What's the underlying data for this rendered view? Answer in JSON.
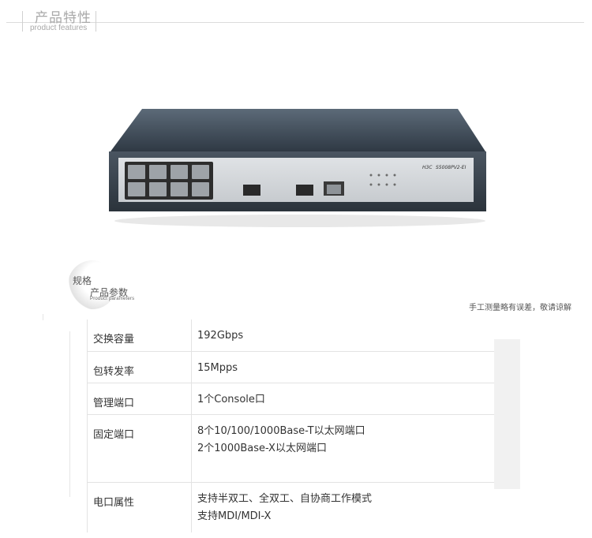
{
  "header": {
    "title": "产品特性",
    "subtitle": "product features"
  },
  "product_image": {
    "brand": "H3C",
    "model": "S5008PV2-EI"
  },
  "specs": {
    "heading_cn": "规格",
    "heading_param": "产品参数",
    "heading_en": "Product parameters",
    "note": "手工测量略有误差，敬请谅解",
    "rows": [
      {
        "label": "交换容量",
        "value": [
          "192Gbps"
        ]
      },
      {
        "label": "包转发率",
        "value": [
          "15Mpps"
        ]
      },
      {
        "label": "管理端口",
        "value": [
          "1个Console口"
        ]
      },
      {
        "label": "固定端口",
        "value": [
          "8个10/100/1000Base-T以太网端口",
          "2个1000Base-X以太网端口"
        ]
      },
      {
        "label": "电口属性",
        "value": [
          "支持半双工、全双工、自协商工作模式",
          "支持MDI/MDI-X"
        ]
      }
    ]
  }
}
